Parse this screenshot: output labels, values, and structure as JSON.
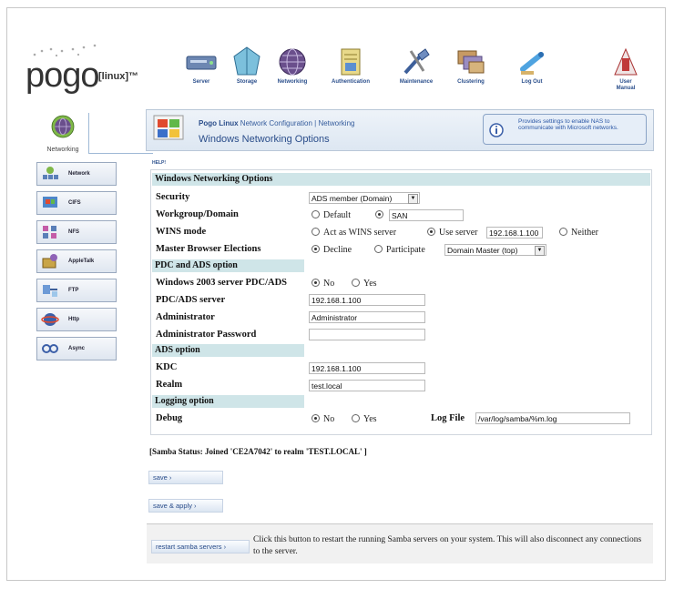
{
  "brand": {
    "logo_text": "pogo",
    "logo_sub": "[linux]™"
  },
  "topnav": [
    {
      "label": "Server",
      "icon": "server-icon"
    },
    {
      "label": "Storage",
      "icon": "storage-icon"
    },
    {
      "label": "Networking",
      "icon": "networking-globe-icon"
    },
    {
      "label": "Authentication",
      "icon": "authentication-icon"
    },
    {
      "label": "Maintenance",
      "icon": "maintenance-icon"
    },
    {
      "label": "Clustering",
      "icon": "clustering-icon"
    },
    {
      "label": "Log Out",
      "icon": "logout-icon"
    },
    {
      "label": "User Manual",
      "icon": "user-manual-icon"
    }
  ],
  "sidebar": {
    "current": "Networking",
    "items": [
      {
        "label": "Network",
        "icon": "network-icon"
      },
      {
        "label": "CIFS",
        "icon": "cifs-icon"
      },
      {
        "label": "NFS",
        "icon": "nfs-icon"
      },
      {
        "label": "AppleTalk",
        "icon": "appletalk-icon"
      },
      {
        "label": "FTP",
        "icon": "ftp-icon"
      },
      {
        "label": "Http",
        "icon": "http-icon"
      },
      {
        "label": "Async",
        "icon": "async-icon"
      }
    ]
  },
  "header": {
    "brand_bold": "Pogo Linux",
    "brand_rest": " Network Configuration | Networking",
    "title": "Windows Networking Options",
    "notice": "Provides settings to enable NAS to communicate with Microsoft networks.",
    "help": "HELP!"
  },
  "form": {
    "section_main": "Windows Networking Options",
    "security": {
      "label": "Security",
      "value": "ADS member (Domain)"
    },
    "workgroup": {
      "label": "Workgroup/Domain",
      "opt_default": "Default",
      "value": "SAN"
    },
    "wins": {
      "label": "WINS mode",
      "opt_act": "Act as WINS server",
      "opt_use": "Use server",
      "server": "192.168.1.100",
      "opt_neither": "Neither"
    },
    "master": {
      "label": "Master Browser Elections",
      "opt_decline": "Decline",
      "opt_participate": "Participate",
      "value": "Domain Master (top)"
    },
    "section_pdc": "PDC and ADS option",
    "pdc2003": {
      "label": "Windows 2003 server PDC/ADS",
      "opt_no": "No",
      "opt_yes": "Yes"
    },
    "pdcserver": {
      "label": "PDC/ADS server",
      "value": "192.168.1.100"
    },
    "admin": {
      "label": "Administrator",
      "value": "Administrator"
    },
    "adminpw": {
      "label": "Administrator Password",
      "value": ""
    },
    "section_ads": "ADS option",
    "kdc": {
      "label": "KDC",
      "value": "192.168.1.100"
    },
    "realm": {
      "label": "Realm",
      "value": "test.local"
    },
    "section_log": "Logging option",
    "debug": {
      "label": "Debug",
      "opt_no": "No",
      "opt_yes": "Yes",
      "logfile_label": "Log File",
      "logfile": "/var/log/samba/%m.log"
    }
  },
  "status": "[Samba Status: Joined 'CE2A7042' to realm 'TEST.LOCAL' ]",
  "buttons": {
    "save": "save ›",
    "save_apply": "save & apply ›",
    "restart": "restart samba servers ›",
    "restart_desc": "Click this button to restart the running Samba servers on your system. This will also disconnect any connections to the server."
  }
}
